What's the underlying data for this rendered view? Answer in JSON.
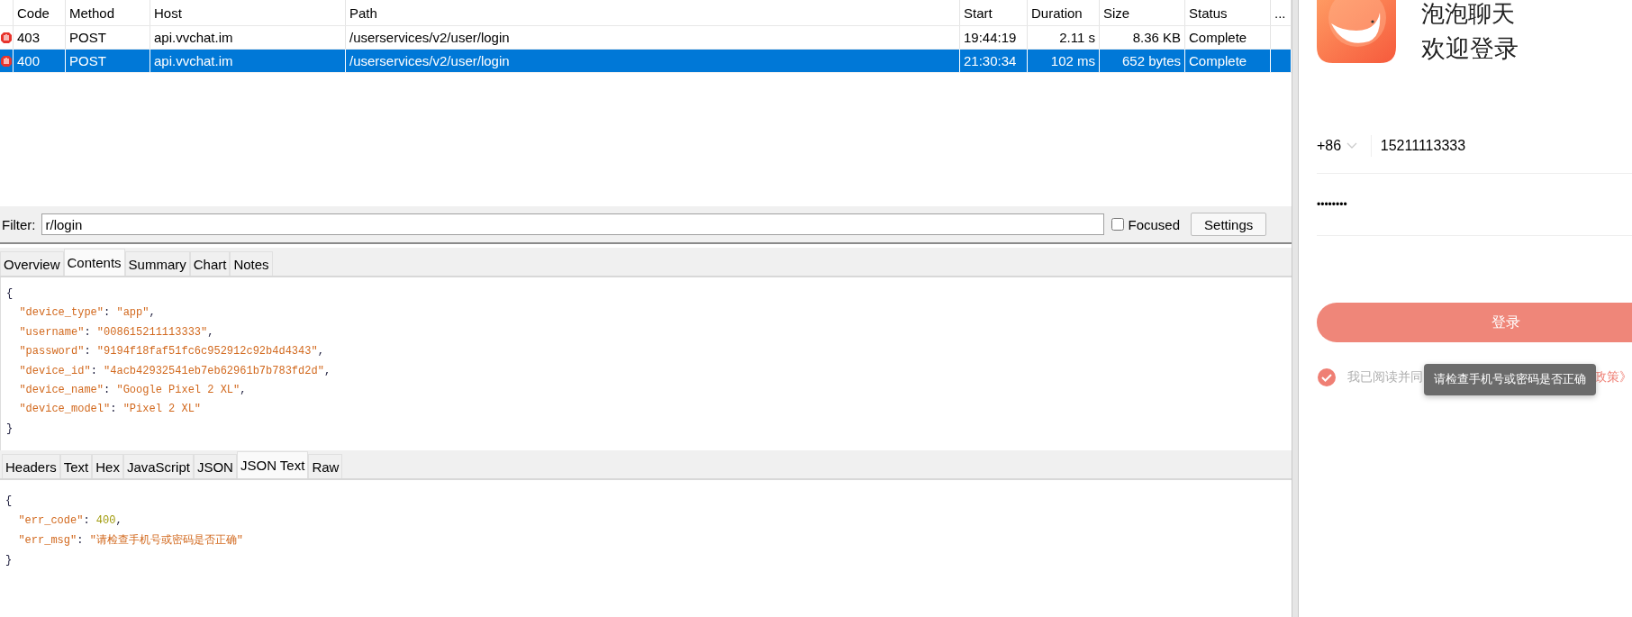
{
  "table": {
    "columns": [
      "Code",
      "Method",
      "Host",
      "Path",
      "Start",
      "Duration",
      "Size",
      "Status",
      "..."
    ],
    "rows": [
      {
        "selected": false,
        "cells": [
          "403",
          "POST",
          "api.vvchat.im",
          "/userservices/v2/user/login",
          "19:44:19",
          "2.11 s",
          "8.36 KB",
          "Complete"
        ]
      },
      {
        "selected": true,
        "cells": [
          "400",
          "POST",
          "api.vvchat.im",
          "/userservices/v2/user/login",
          "21:30:34",
          "102 ms",
          "652 bytes",
          "Complete"
        ]
      }
    ]
  },
  "filter": {
    "label": "Filter:",
    "value": "r/login",
    "focused_label": "Focused",
    "focused_checked": false,
    "settings_button": "Settings"
  },
  "request_tabs": [
    {
      "label": "Overview",
      "selected": false
    },
    {
      "label": "Contents",
      "selected": true
    },
    {
      "label": "Summary",
      "selected": false
    },
    {
      "label": "Chart",
      "selected": false
    },
    {
      "label": "Notes",
      "selected": false
    }
  ],
  "request_body": [
    [
      {
        "kind": "punct",
        "text": "{"
      }
    ],
    [
      {
        "kind": "key",
        "text": "  \"device_type\""
      },
      {
        "kind": "punct",
        "text": ": "
      },
      {
        "kind": "string",
        "text": "\"app\""
      },
      {
        "kind": "punct",
        "text": ","
      }
    ],
    [
      {
        "kind": "key",
        "text": "  \"username\""
      },
      {
        "kind": "punct",
        "text": ": "
      },
      {
        "kind": "string",
        "text": "\"008615211113333\""
      },
      {
        "kind": "punct",
        "text": ","
      }
    ],
    [
      {
        "kind": "key",
        "text": "  \"password\""
      },
      {
        "kind": "punct",
        "text": ": "
      },
      {
        "kind": "string",
        "text": "\"9194f18faf51fc6c952912c92b4d4343\""
      },
      {
        "kind": "punct",
        "text": ","
      }
    ],
    [
      {
        "kind": "key",
        "text": "  \"device_id\""
      },
      {
        "kind": "punct",
        "text": ": "
      },
      {
        "kind": "string",
        "text": "\"4acb42932541eb7eb62961b7b783fd2d\""
      },
      {
        "kind": "punct",
        "text": ","
      }
    ],
    [
      {
        "kind": "key",
        "text": "  \"device_name\""
      },
      {
        "kind": "punct",
        "text": ": "
      },
      {
        "kind": "string",
        "text": "\"Google Pixel 2 XL\""
      },
      {
        "kind": "punct",
        "text": ","
      }
    ],
    [
      {
        "kind": "key",
        "text": "  \"device_model\""
      },
      {
        "kind": "punct",
        "text": ": "
      },
      {
        "kind": "string",
        "text": "\"Pixel 2 XL\""
      }
    ],
    [
      {
        "kind": "punct",
        "text": "}"
      }
    ]
  ],
  "response_tabs": [
    {
      "label": "Headers",
      "selected": false
    },
    {
      "label": "Text",
      "selected": false
    },
    {
      "label": "Hex",
      "selected": false
    },
    {
      "label": "JavaScript",
      "selected": false
    },
    {
      "label": "JSON",
      "selected": false
    },
    {
      "label": "JSON Text",
      "selected": true
    },
    {
      "label": "Raw",
      "selected": false
    }
  ],
  "response_body": [
    [
      {
        "kind": "punct",
        "text": "{"
      }
    ],
    [
      {
        "kind": "key",
        "text": "  \"err_code\""
      },
      {
        "kind": "punct",
        "text": ": "
      },
      {
        "kind": "number",
        "text": "400"
      },
      {
        "kind": "punct",
        "text": ","
      }
    ],
    [
      {
        "kind": "key",
        "text": "  \"err_msg\""
      },
      {
        "kind": "punct",
        "text": ": "
      },
      {
        "kind": "string",
        "text": "\"请检查手机号或密码是否正确\""
      }
    ],
    [
      {
        "kind": "punct",
        "text": "}"
      }
    ]
  ],
  "phone": {
    "app_title": "泡泡聊天",
    "welcome": "欢迎登录",
    "country_code": "+86",
    "phone_number": "15211113333",
    "password": "••••••••",
    "login_button": "登录",
    "agree_checked": true,
    "agreement_start": "我已阅读并同",
    "agreement_end": "政策》",
    "toast": "请检查手机号或密码是否正确"
  }
}
